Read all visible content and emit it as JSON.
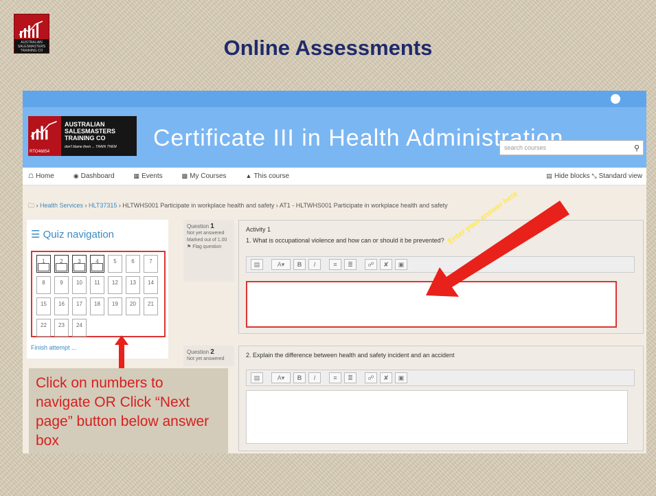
{
  "slide": {
    "title": "Online Assessments"
  },
  "site": {
    "logo_lines": [
      "AUSTRALIAN",
      "SALESMASTERS",
      "TRAINING CO"
    ],
    "logo_tagline": "don't blame them ... TRAIN THEM",
    "logo_code": "RTO46854",
    "course_title": "Certificate III in Health Administration",
    "search_placeholder": "search courses"
  },
  "nav": {
    "home": "Home",
    "dashboard": "Dashboard",
    "events": "Events",
    "my_courses": "My Courses",
    "this_course": "This course",
    "hide_blocks": "Hide blocks",
    "standard_view": "Standard view"
  },
  "breadcrumb": [
    "Health Services",
    "HLT37315",
    "HLTWHS001 Participate in workplace health and safety",
    "AT1 - HLTWHS001 Participate in workplace health and safety"
  ],
  "quiz_nav": {
    "title": "Quiz navigation",
    "answered": [
      1,
      2,
      3,
      4
    ],
    "buttons": [
      "1",
      "2",
      "3",
      "4",
      "5",
      "6",
      "7",
      "8",
      "9",
      "10",
      "11",
      "12",
      "13",
      "14",
      "15",
      "16",
      "17",
      "18",
      "19",
      "20",
      "21",
      "22",
      "23",
      "24"
    ],
    "finish": "Finish attempt ..."
  },
  "q1": {
    "label": "Question",
    "number": "1",
    "status": "Not yet answered",
    "marked": "Marked out of 1.00",
    "flag": "Flag question",
    "activity": "Activity 1",
    "text": "1. What is occupational violence and how can or should it be prevented?"
  },
  "q2": {
    "label": "Question",
    "number": "2",
    "status": "Not yet answered",
    "text": "2. Explain the difference between health and safety incident and an accident"
  },
  "annotations": {
    "enter_answer": "Enter your answer here",
    "callout": "Click on numbers to navigate OR Click “Next page” button below answer box"
  },
  "colors": {
    "accent_red": "#d33",
    "link_blue": "#3a8bc0",
    "banner_blue": "#7ab6f2",
    "title_navy": "#1f2a6b"
  }
}
